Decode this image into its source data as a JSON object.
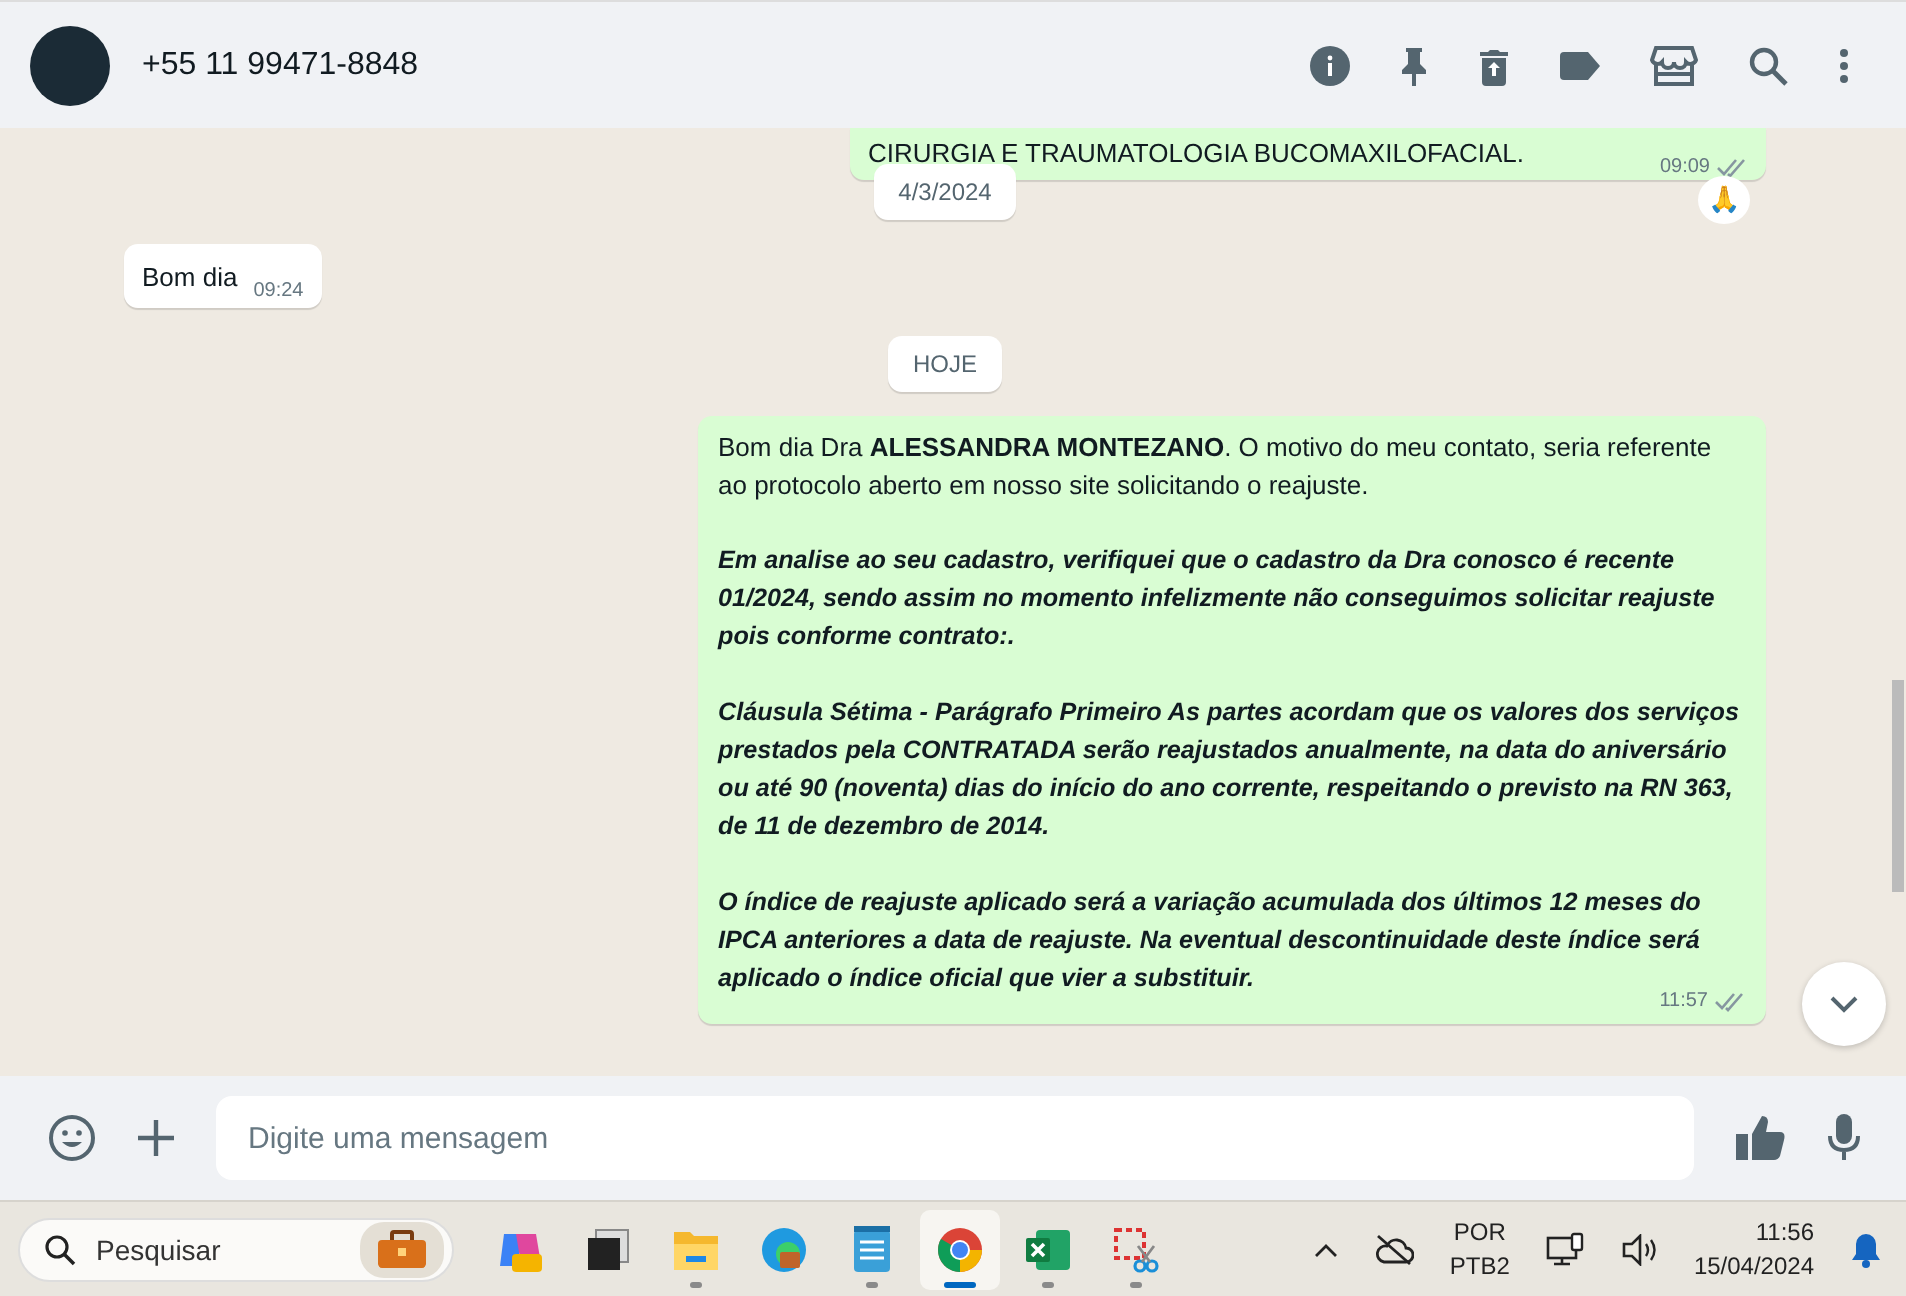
{
  "header": {
    "contact": "+55 11 99471-8848"
  },
  "chat": {
    "top_message": {
      "text": "CIRURGIA E TRAUMATOLOGIA BUCOMAXILOFACIAL.",
      "time": "09:09",
      "reaction": "🙏"
    },
    "date_chip": "4/3/2024",
    "incoming": {
      "text": "Bom dia",
      "time": "09:24"
    },
    "today_chip": "HOJE",
    "outgoing": {
      "time": "11:57",
      "paragraphs": [
        {
          "kind": "plain",
          "text": "Bom dia Dra **ALESSANDRA MONTEZANO**. O motivo do meu contato, seria referente ao protocolo aberto em nosso site solicitando o reajuste."
        },
        {
          "kind": "emphasis",
          "text": "Em analise ao seu cadastro, verifiquei que o cadastro da Dra conosco é recente 01/2024, sendo assim no momento infelizmente não conseguimos solicitar reajuste pois conforme contrato:."
        },
        {
          "kind": "emphasis",
          "text": "Cláusula Sétima - Parágrafo Primeiro  As partes acordam que os valores dos serviços prestados pela CONTRATADA serão reajustados anualmente, na data do aniversário ou até 90 (noventa) dias do início do ano corrente, respeitando o previsto na RN 363, de 11 de dezembro de 2014."
        },
        {
          "kind": "emphasis",
          "text": "O índice de reajuste aplicado será a variação acumulada dos últimos 12 meses do IPCA anteriores a data de reajuste. Na eventual descontinuidade deste índice será aplicado o índice oficial que vier a substituir."
        }
      ]
    }
  },
  "composer": {
    "placeholder": "Digite uma mensagem"
  },
  "taskbar": {
    "search_placeholder": "Pesquisar",
    "apps": [
      {
        "kind": "copilot",
        "running": false,
        "selected": false
      },
      {
        "kind": "windows",
        "running": false,
        "selected": false
      },
      {
        "kind": "folder",
        "running": true,
        "selected": false
      },
      {
        "kind": "edge",
        "running": false,
        "selected": false
      },
      {
        "kind": "notepad",
        "running": true,
        "selected": false
      },
      {
        "kind": "chrome",
        "running": true,
        "selected": true
      },
      {
        "kind": "excel",
        "running": true,
        "selected": false
      },
      {
        "kind": "snip",
        "running": true,
        "selected": false
      }
    ],
    "language": "POR",
    "layout": "PTB2",
    "time": "11:56",
    "date": "15/04/2024"
  }
}
